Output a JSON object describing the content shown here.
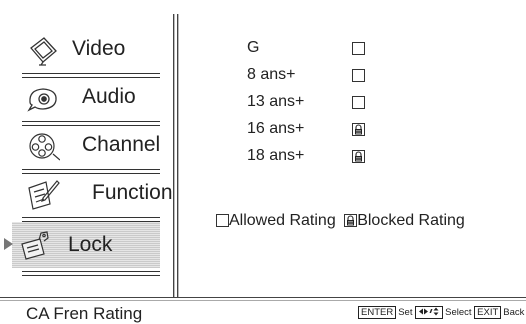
{
  "menu": [
    {
      "label": "Video",
      "icon": "tv-icon"
    },
    {
      "label": "Audio",
      "icon": "speaker-icon"
    },
    {
      "label": "Channel",
      "icon": "film-reel-icon"
    },
    {
      "label": "Function",
      "icon": "notepad-icon"
    },
    {
      "label": "Lock",
      "icon": "lock-icon",
      "selected": true
    }
  ],
  "ratings": [
    {
      "label": "G",
      "state": "allowed"
    },
    {
      "label": "8 ans+",
      "state": "allowed"
    },
    {
      "label": "13 ans+",
      "state": "allowed"
    },
    {
      "label": "16 ans+",
      "state": "blocked"
    },
    {
      "label": "18 ans+",
      "state": "blocked"
    }
  ],
  "legend": {
    "allowed": "Allowed Rating",
    "blocked": "Blocked Rating"
  },
  "footer": {
    "title": "CA Fren Rating",
    "enter_key": "ENTER",
    "set_label": "Set",
    "select_label": "Select",
    "exit_key": "EXIT",
    "back_label": "Back"
  }
}
